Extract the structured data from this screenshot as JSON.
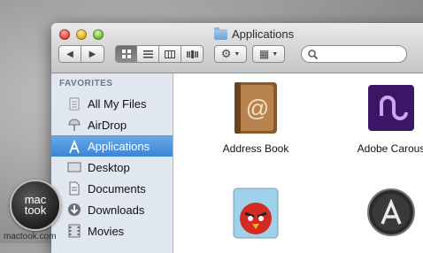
{
  "window": {
    "title": "Applications"
  },
  "toolbar": {
    "back_label": "◀",
    "forward_label": "▶",
    "action_label": "⚙",
    "arrange_label": "▦",
    "search_placeholder": ""
  },
  "sidebar": {
    "section": "FAVORITES",
    "items": [
      {
        "label": "All My Files",
        "icon": "all-files-icon"
      },
      {
        "label": "AirDrop",
        "icon": "airdrop-icon"
      },
      {
        "label": "Applications",
        "icon": "applications-icon",
        "selected": true
      },
      {
        "label": "Desktop",
        "icon": "desktop-icon"
      },
      {
        "label": "Documents",
        "icon": "documents-icon"
      },
      {
        "label": "Downloads",
        "icon": "downloads-icon"
      },
      {
        "label": "Movies",
        "icon": "movies-icon"
      }
    ]
  },
  "apps": [
    {
      "label": "Address Book",
      "icon": "address-book-icon"
    },
    {
      "label": "Adobe Carous",
      "icon": "adobe-carousel-icon"
    },
    {
      "label": "",
      "icon": "angry-birds-icon"
    },
    {
      "label": "",
      "icon": "app-store-icon"
    }
  ],
  "watermark": {
    "line1": "mac",
    "line2": "took",
    "url": "mactook.com"
  },
  "colors": {
    "selection": "#3a85d6",
    "sidebar_bg": "#e1e7ef"
  }
}
